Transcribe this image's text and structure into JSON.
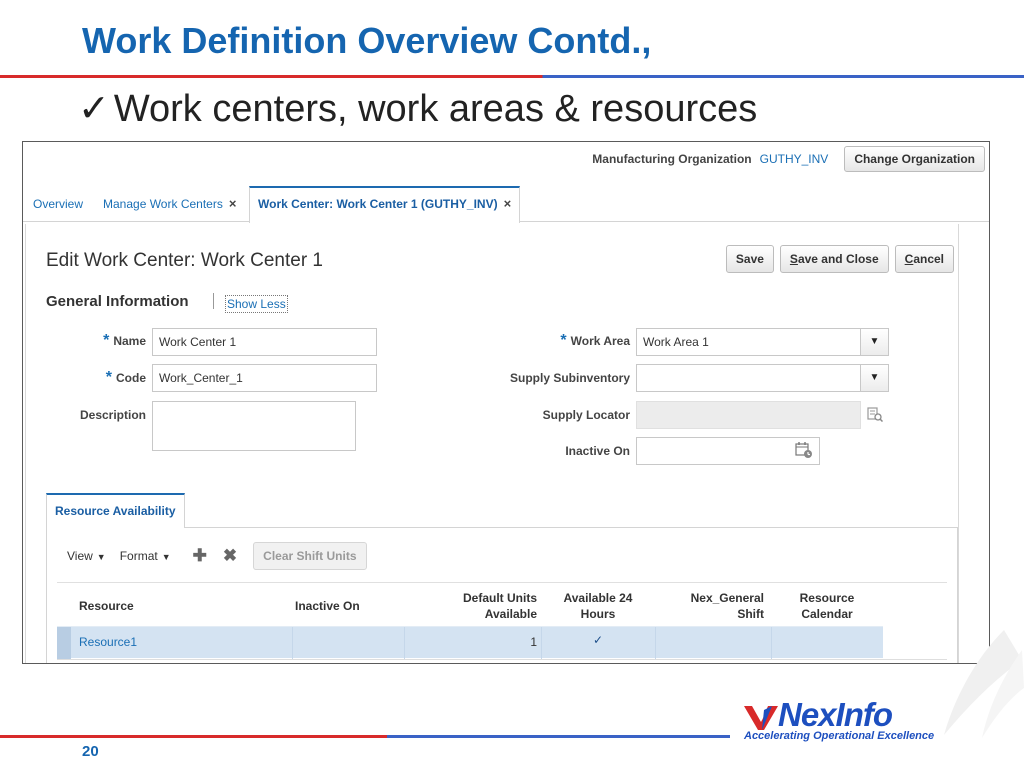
{
  "slide": {
    "title": "Work Definition Overview Contd.,",
    "bullet_check": "✓",
    "bullet": "Work centers, work areas & resources",
    "page_number": "20"
  },
  "logo": {
    "name": "NexInfo",
    "tagline": "Accelerating Operational Excellence",
    "colors": {
      "red": "#d82a2a",
      "blue": "#1d4fbf"
    }
  },
  "header": {
    "org_label": "Manufacturing Organization",
    "org_value": "GUTHY_INV",
    "change_org": "Change Organization"
  },
  "tabs": [
    {
      "label": "Overview"
    },
    {
      "label": "Manage Work Centers",
      "close": "×"
    },
    {
      "label": "Work Center: Work Center 1 (GUTHY_INV)",
      "close": "×"
    }
  ],
  "page": {
    "title": "Edit Work Center: Work Center 1",
    "save": "Save",
    "save_close_first": "S",
    "save_close_rest": "ave and Close",
    "cancel_first": "C",
    "cancel_rest": "ancel"
  },
  "general": {
    "title": "General Information",
    "toggle": "Show Less",
    "required_mark": "*",
    "name_label": "Name",
    "name_value": "Work Center 1",
    "code_label": "Code",
    "code_value": "Work_Center_1",
    "description_label": "Description",
    "description_value": "",
    "work_area_label": "Work Area",
    "work_area_value": "Work Area 1",
    "supply_subinventory_label": "Supply Subinventory",
    "supply_subinventory_value": "",
    "supply_locator_label": "Supply Locator",
    "inactive_on_label": "Inactive On",
    "inactive_on_value": ""
  },
  "resource_availability": {
    "tab": "Resource Availability",
    "view": "View",
    "format": "Format",
    "clear": "Clear Shift Units",
    "columns": {
      "resource": "Resource",
      "inactive_on": "Inactive On",
      "default_units_1": "Default Units",
      "default_units_2": "Available",
      "available_1": "Available 24",
      "available_2": "Hours",
      "shift_1": "Nex_General",
      "shift_2": "Shift",
      "calendar_1": "Resource",
      "calendar_2": "Calendar"
    },
    "rows": [
      {
        "resource": "Resource1",
        "inactive_on": "",
        "default_units": "1",
        "available_24": "✓",
        "shift": "",
        "calendar": ""
      }
    ]
  }
}
